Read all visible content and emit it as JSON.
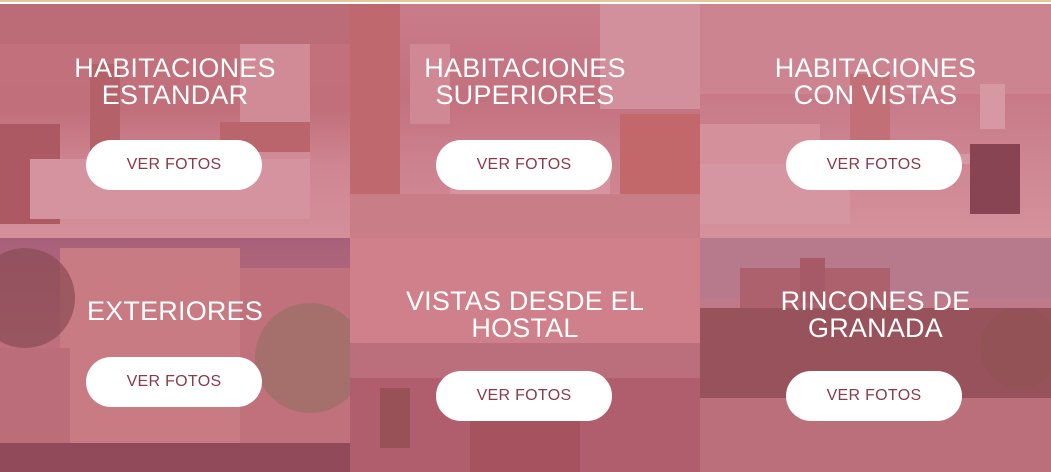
{
  "tiles": [
    {
      "title_line1": "HABITACIONES",
      "title_line2": "ESTANDAR",
      "button": "VER FOTOS"
    },
    {
      "title_line1": "HABITACIONES",
      "title_line2": "SUPERIORES",
      "button": "VER FOTOS"
    },
    {
      "title_line1": "HABITACIONES",
      "title_line2": "CON VISTAS",
      "button": "VER FOTOS"
    },
    {
      "title_line1": "EXTERIORES",
      "title_line2": "",
      "button": "VER FOTOS"
    },
    {
      "title_line1": "VISTAS DESDE EL",
      "title_line2": "HOSTAL",
      "button": "VER FOTOS"
    },
    {
      "title_line1": "RINCONES DE",
      "title_line2": "GRANADA",
      "button": "VER FOTOS"
    }
  ],
  "colors": {
    "overlay": "#be5a6e",
    "button_bg": "#ffffff",
    "button_text": "#8a3a48",
    "top_border": "#e2c99a"
  }
}
